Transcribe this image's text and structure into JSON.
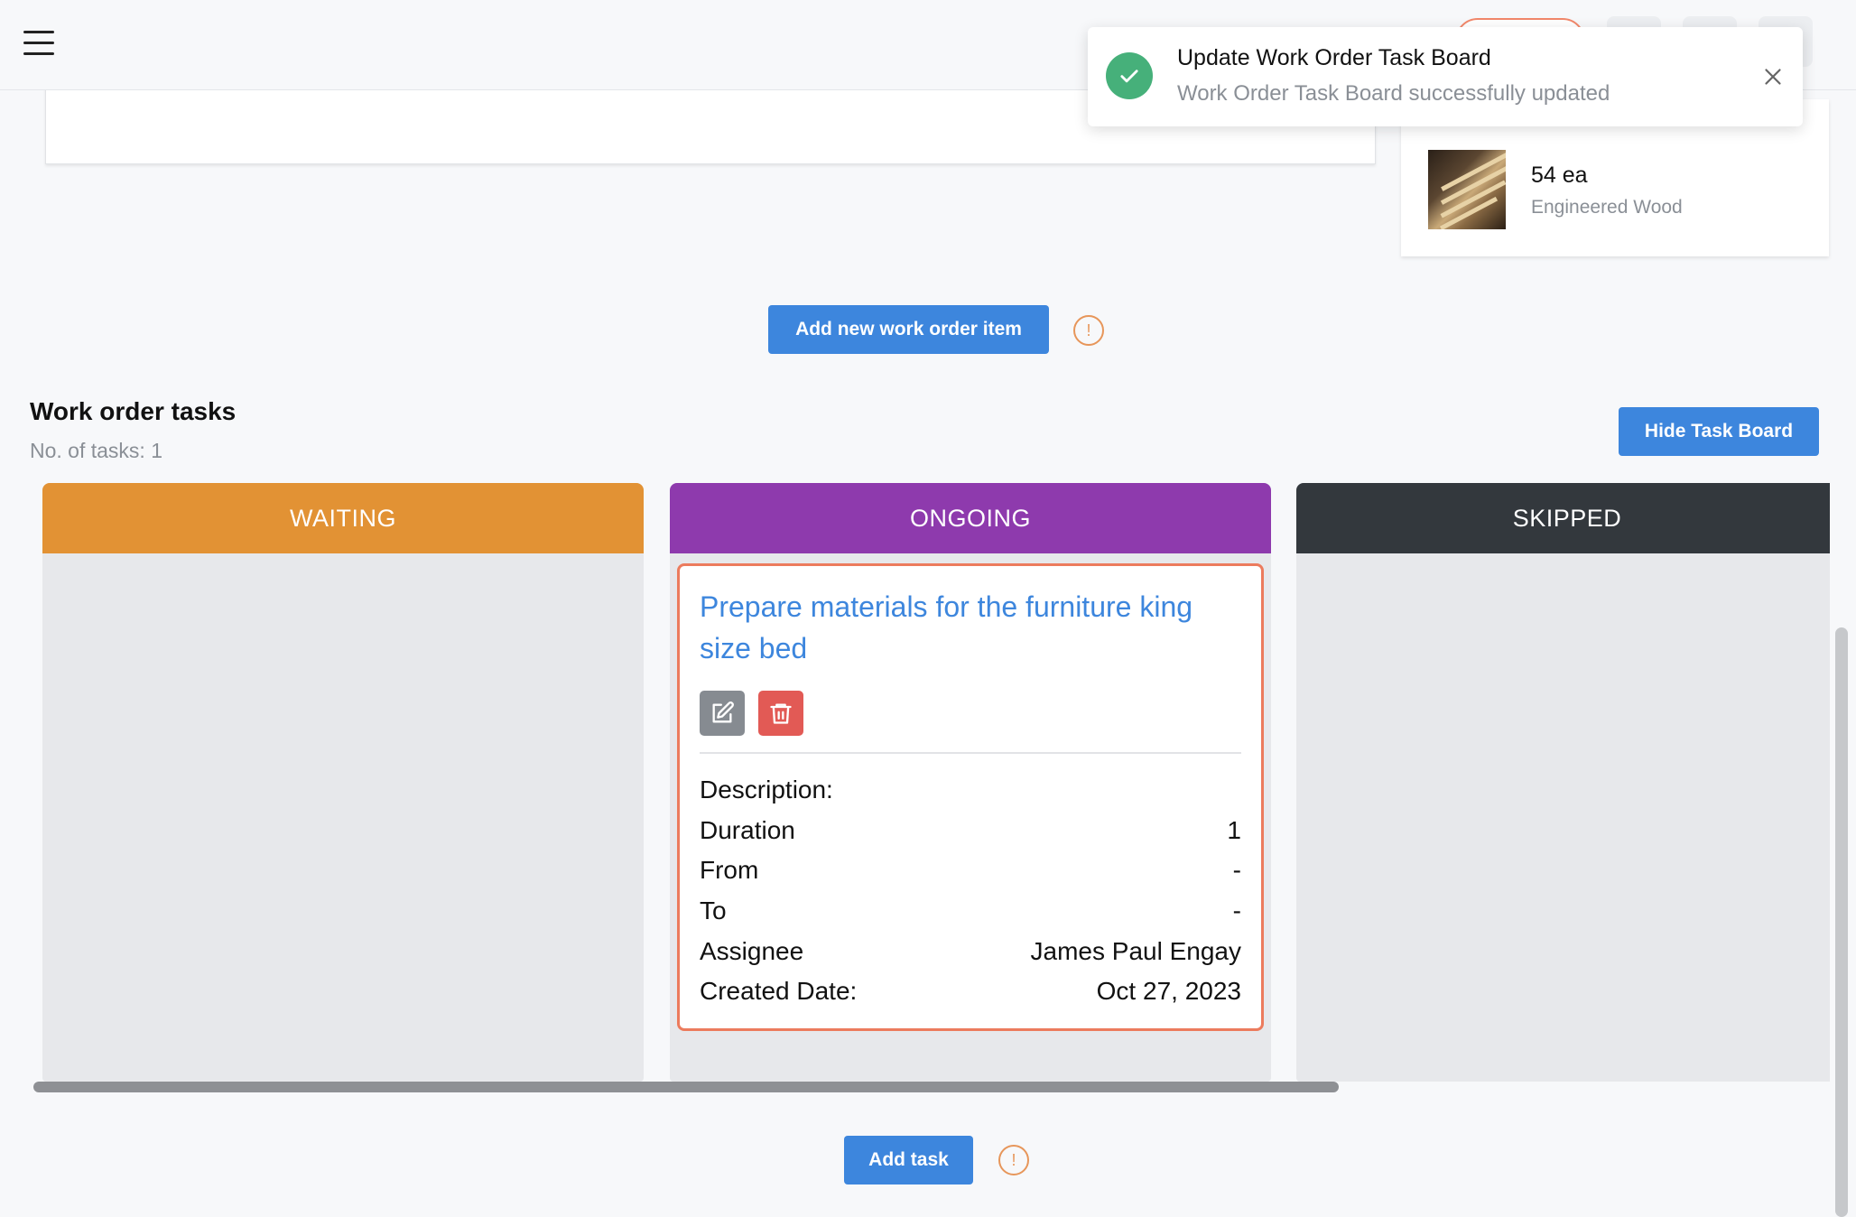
{
  "header": {
    "menu_icon": "hamburger-icon"
  },
  "toast": {
    "title": "Update Work Order Task Board",
    "message": "Work Order Task Board successfully updated",
    "status_color": "#46b07a"
  },
  "material": {
    "quantity": "54 ea",
    "name": "Engineered Wood"
  },
  "actions": {
    "add_item_label": "Add new work order item",
    "add_task_label": "Add task",
    "hide_board_label": "Hide Task Board"
  },
  "tasks_section": {
    "title": "Work order tasks",
    "count_text": "No. of tasks: 1"
  },
  "columns": [
    {
      "label": "WAITING",
      "color": "#e29234"
    },
    {
      "label": "ONGOING",
      "color": "#8e3aad"
    },
    {
      "label": "SKIPPED",
      "color": "#33383d"
    }
  ],
  "task_card": {
    "title": "Prepare materials for the furniture king size bed",
    "details": [
      {
        "label": "Description:",
        "value": ""
      },
      {
        "label": "Duration",
        "value": "1"
      },
      {
        "label": "From",
        "value": "-"
      },
      {
        "label": "To",
        "value": "-"
      },
      {
        "label": "Assignee",
        "value": "James Paul Engay"
      },
      {
        "label": "Created Date:",
        "value": "Oct 27, 2023"
      }
    ]
  },
  "colors": {
    "accent": "#3d86dd",
    "danger": "#e25a55",
    "card_border": "#ec7b5d"
  }
}
